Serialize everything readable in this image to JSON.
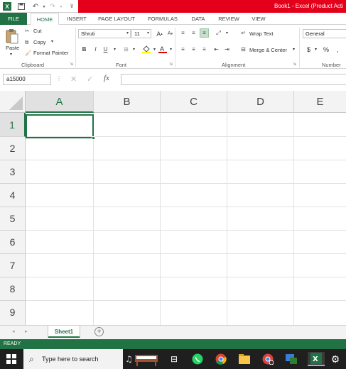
{
  "window": {
    "title": "Book1 - Excel (Product Acti"
  },
  "quick_access": {
    "icons": [
      "excel-logo-icon",
      "save-icon",
      "undo-icon",
      "redo-icon",
      "customize-icon"
    ]
  },
  "tabs": [
    {
      "label": "FILE",
      "active": false
    },
    {
      "label": "HOME",
      "active": true
    },
    {
      "label": "INSERT",
      "active": false
    },
    {
      "label": "PAGE LAYOUT",
      "active": false
    },
    {
      "label": "FORMULAS",
      "active": false
    },
    {
      "label": "DATA",
      "active": false
    },
    {
      "label": "REVIEW",
      "active": false
    },
    {
      "label": "VIEW",
      "active": false
    }
  ],
  "ribbon": {
    "clipboard": {
      "paste": "Paste",
      "cut": "Cut",
      "copy": "Copy",
      "format_painter": "Format Painter",
      "label": "Clipboard"
    },
    "font": {
      "name": "Shruti",
      "size": "11",
      "bold": "B",
      "italic": "I",
      "underline": "U",
      "label": "Font"
    },
    "alignment": {
      "wrap_text": "Wrap Text",
      "merge_center": "Merge & Center",
      "label": "Alignment"
    },
    "number": {
      "format": "General",
      "currency": "$",
      "percent": "%",
      "label": "Number"
    }
  },
  "formula_bar": {
    "name_box": "a15000",
    "fx": "fx",
    "value": ""
  },
  "grid": {
    "columns": [
      "A",
      "B",
      "C",
      "D",
      "E"
    ],
    "rows": [
      "1",
      "2",
      "3",
      "4",
      "5",
      "6",
      "7",
      "8",
      "9"
    ],
    "selected_cell": "A1"
  },
  "sheets": [
    {
      "label": "Sheet1",
      "active": true
    }
  ],
  "status": {
    "text": "READY"
  },
  "taskbar": {
    "search_placeholder": "Type here to search"
  },
  "colors": {
    "excel_green": "#217346",
    "title_red": "#e4001b",
    "taskbar": "#1f1f1f"
  }
}
